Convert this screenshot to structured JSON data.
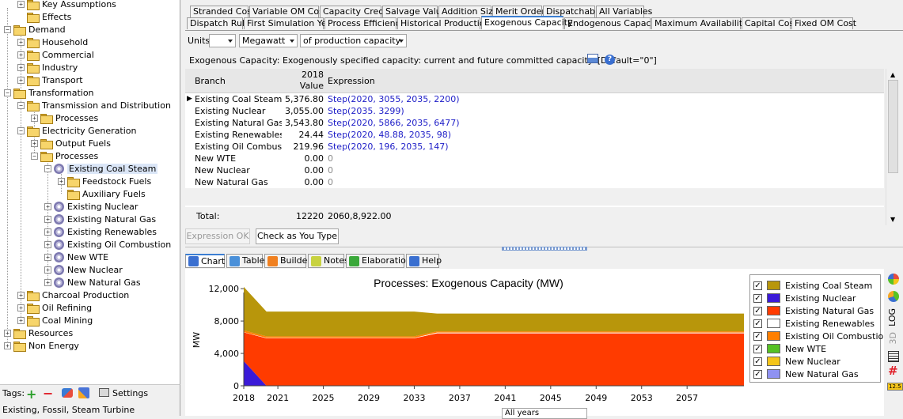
{
  "tree": [
    {
      "label": "Key Assumptions",
      "x": 22,
      "y": 5,
      "exp": "+"
    },
    {
      "label": "Effects",
      "x": 22,
      "y": 21,
      "exp": ""
    },
    {
      "label": "Demand",
      "x": 5,
      "y": 37,
      "exp": "-"
    },
    {
      "label": "Household",
      "x": 22,
      "y": 53,
      "exp": "+"
    },
    {
      "label": "Commercial",
      "x": 22,
      "y": 69,
      "exp": "+"
    },
    {
      "label": "Industry",
      "x": 22,
      "y": 85,
      "exp": "+"
    },
    {
      "label": "Transport",
      "x": 22,
      "y": 101,
      "exp": "+"
    },
    {
      "label": "Transformation",
      "x": 5,
      "y": 117,
      "exp": "-"
    },
    {
      "label": "Transmission and Distribution",
      "x": 22,
      "y": 133,
      "exp": "-"
    },
    {
      "label": "Processes",
      "x": 39,
      "y": 149,
      "exp": "+"
    },
    {
      "label": "Electricity Generation",
      "x": 22,
      "y": 165,
      "exp": "-"
    },
    {
      "label": "Output Fuels",
      "x": 39,
      "y": 181,
      "exp": "+"
    },
    {
      "label": "Processes",
      "x": 39,
      "y": 197,
      "exp": "-"
    },
    {
      "label": "Existing Coal Steam",
      "x": 56,
      "y": 213,
      "exp": "-",
      "gear": true,
      "sel": true
    },
    {
      "label": "Feedstock Fuels",
      "x": 73,
      "y": 229,
      "exp": "+"
    },
    {
      "label": "Auxiliary Fuels",
      "x": 73,
      "y": 245,
      "exp": ""
    },
    {
      "label": "Existing Nuclear",
      "x": 56,
      "y": 261,
      "exp": "+",
      "gear": true
    },
    {
      "label": "Existing Natural Gas",
      "x": 56,
      "y": 277,
      "exp": "+",
      "gear": true
    },
    {
      "label": "Existing Renewables",
      "x": 56,
      "y": 293,
      "exp": "+",
      "gear": true
    },
    {
      "label": "Existing Oil Combustion",
      "x": 56,
      "y": 309,
      "exp": "+",
      "gear": true
    },
    {
      "label": "New WTE",
      "x": 56,
      "y": 325,
      "exp": "+",
      "gear": true
    },
    {
      "label": "New Nuclear",
      "x": 56,
      "y": 341,
      "exp": "+",
      "gear": true
    },
    {
      "label": "New Natural Gas",
      "x": 56,
      "y": 357,
      "exp": "+",
      "gear": true
    },
    {
      "label": "Charcoal Production",
      "x": 22,
      "y": 373,
      "exp": "+"
    },
    {
      "label": "Oil Refining",
      "x": 22,
      "y": 389,
      "exp": "+"
    },
    {
      "label": "Coal Mining",
      "x": 22,
      "y": 405,
      "exp": "+"
    },
    {
      "label": "Resources",
      "x": 5,
      "y": 421,
      "exp": "+"
    },
    {
      "label": "Non Energy",
      "x": 5,
      "y": 437,
      "exp": "+"
    }
  ],
  "tags": {
    "label": "Tags:",
    "settings": "Settings",
    "value": "Existing, Fossil, Steam Turbine"
  },
  "tabs_row1": [
    "Stranded Cost",
    "Variable OM Cost",
    "Capacity Credit",
    "Salvage Value",
    "Addition Size",
    "Merit Order",
    "Dispatchable",
    "All Variables"
  ],
  "tabs_row2": [
    "Dispatch Rule",
    "First Simulation Year",
    "Process Efficiency",
    "Historical Production",
    "Exogenous Capacity",
    "Endogenous Capacity",
    "Maximum Availability",
    "Capital Cost",
    "Fixed OM Cost"
  ],
  "units": {
    "label": "Units:",
    "scale": "",
    "unit": "Megawatt",
    "basis": "of production capacity"
  },
  "description": "Exogenous Capacity: Exogenously specified capacity: current and future committed capacity. [Default=\"0\"]",
  "grid": {
    "col_branch": "Branch",
    "col_year": "2018",
    "col_value": "Value",
    "col_expr": "Expression",
    "rows": [
      {
        "branch": "Existing Coal Steam",
        "value": "5,376.80",
        "expr": "Step(2020, 3055, 2035, 2200)"
      },
      {
        "branch": "Existing Nuclear",
        "value": "3,055.00",
        "expr": "Step(2035. 3299)"
      },
      {
        "branch": "Existing Natural Gas",
        "value": "3,543.80",
        "expr": "Step(2020, 5866, 2035, 6477)"
      },
      {
        "branch": "Existing Renewables",
        "value": "24.44",
        "expr": "Step(2020, 48.88, 2035, 98)"
      },
      {
        "branch": "Existing Oil Combusti...",
        "value": "219.96",
        "expr": "Step(2020, 196, 2035, 147)"
      },
      {
        "branch": "New WTE",
        "value": "0.00",
        "expr": "0"
      },
      {
        "branch": "New Nuclear",
        "value": "0.00",
        "expr": "0"
      },
      {
        "branch": "New Natural Gas",
        "value": "0.00",
        "expr": "0"
      }
    ],
    "total_label": "Total:",
    "total_value": "12220",
    "total_expr": "2060,8,922.00"
  },
  "expr_buttons": {
    "ok": "Expression OK",
    "check": "Check as You Type"
  },
  "lower_tabs": [
    "Chart",
    "Table",
    "Builder",
    "Notes",
    "Elaboration",
    "Help"
  ],
  "right_toolbar": {
    "log": "LOG",
    "three_d": "3D",
    "badge": "12.5"
  },
  "footer_select": "All years",
  "chart_data": {
    "type": "area",
    "title": "Processes: Exogenous Capacity (MW)",
    "ylabel": "MW",
    "ylim": [
      0,
      12500
    ],
    "yticks": [
      0,
      4000,
      8000,
      12000
    ],
    "ytick_labels": [
      "0",
      "4,000",
      "8,000",
      "12,000"
    ],
    "xlim": [
      2018,
      2062
    ],
    "xticks": [
      2018,
      2021,
      2025,
      2029,
      2033,
      2037,
      2041,
      2045,
      2049,
      2053,
      2057
    ],
    "x": [
      2018,
      2020,
      2021,
      2032,
      2033,
      2035,
      2036,
      2062
    ],
    "series": [
      {
        "name": "Existing Nuclear",
        "color": "#3b1ad8",
        "values": [
          3055,
          0,
          0,
          0,
          0,
          0,
          0,
          0
        ]
      },
      {
        "name": "Existing Natural Gas",
        "color": "#ff3b00",
        "values": [
          3544,
          5866,
          5866,
          5866,
          5866,
          6477,
          6477,
          6477
        ]
      },
      {
        "name": "Existing Renewables",
        "color": "#ffffff",
        "values": [
          24,
          49,
          49,
          49,
          49,
          98,
          98,
          98
        ]
      },
      {
        "name": "Existing Oil Combustion",
        "color": "#ff7f00",
        "values": [
          220,
          196,
          196,
          196,
          196,
          147,
          147,
          147
        ]
      },
      {
        "name": "Existing Coal Steam",
        "color": "#b8960b",
        "values": [
          5377,
          3055,
          3055,
          3055,
          3055,
          2200,
          2200,
          2200
        ]
      }
    ],
    "legend": [
      {
        "name": "Existing Coal Steam",
        "color": "#b8960b"
      },
      {
        "name": "Existing Nuclear",
        "color": "#3b1ad8"
      },
      {
        "name": "Existing Natural Gas",
        "color": "#ff3b00"
      },
      {
        "name": "Existing Renewables",
        "color": "#ffffff"
      },
      {
        "name": "Existing Oil Combustion",
        "color": "#ff7f00"
      },
      {
        "name": "New WTE",
        "color": "#56c225"
      },
      {
        "name": "New Nuclear",
        "color": "#f5c518"
      },
      {
        "name": "New Natural Gas",
        "color": "#8f92f2"
      }
    ]
  }
}
